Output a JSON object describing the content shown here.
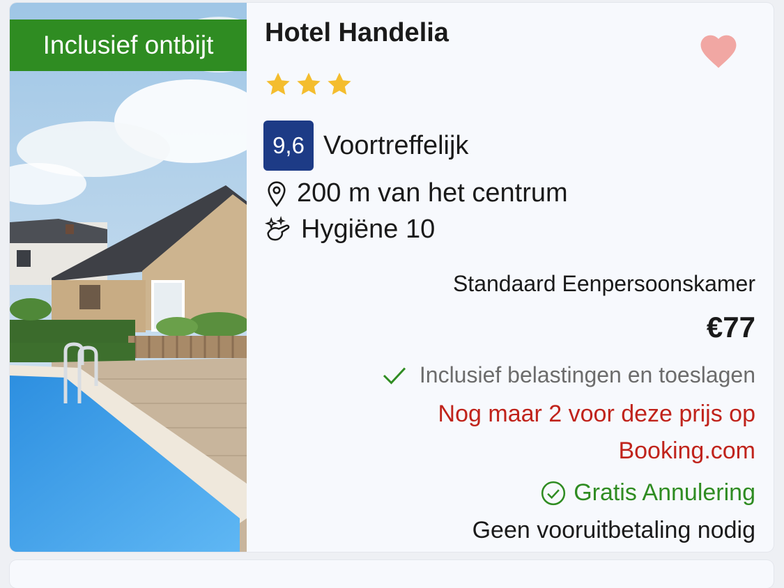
{
  "hotel": {
    "badge": "Inclusief ontbijt",
    "name": "Hotel Handelia",
    "stars": 3,
    "score": "9,6",
    "score_label": "Voortreffelijk",
    "distance": "200 m van het centrum",
    "hygiene": "Hygiëne 10",
    "room_type": "Standaard Eenpersoonskamer",
    "price": "€77",
    "tax_note": "Inclusief belastingen en toeslagen",
    "scarcity_line1": "Nog maar 2 voor deze prijs op",
    "scarcity_line2": "Booking.com",
    "cancellation": "Gratis Annulering",
    "prepayment": "Geen vooruitbetaling nodig"
  },
  "colors": {
    "badge_green": "#2f8c22",
    "score_blue": "#1d3b86",
    "star_yellow": "#f4bd2e",
    "heart_pink": "#f1a7a3",
    "scarcity_red": "#c0231b"
  },
  "icons": [
    "heart-icon",
    "star-icon",
    "map-pin-icon",
    "hygiene-sparkle-icon",
    "checkmark-icon",
    "check-circle-icon"
  ]
}
